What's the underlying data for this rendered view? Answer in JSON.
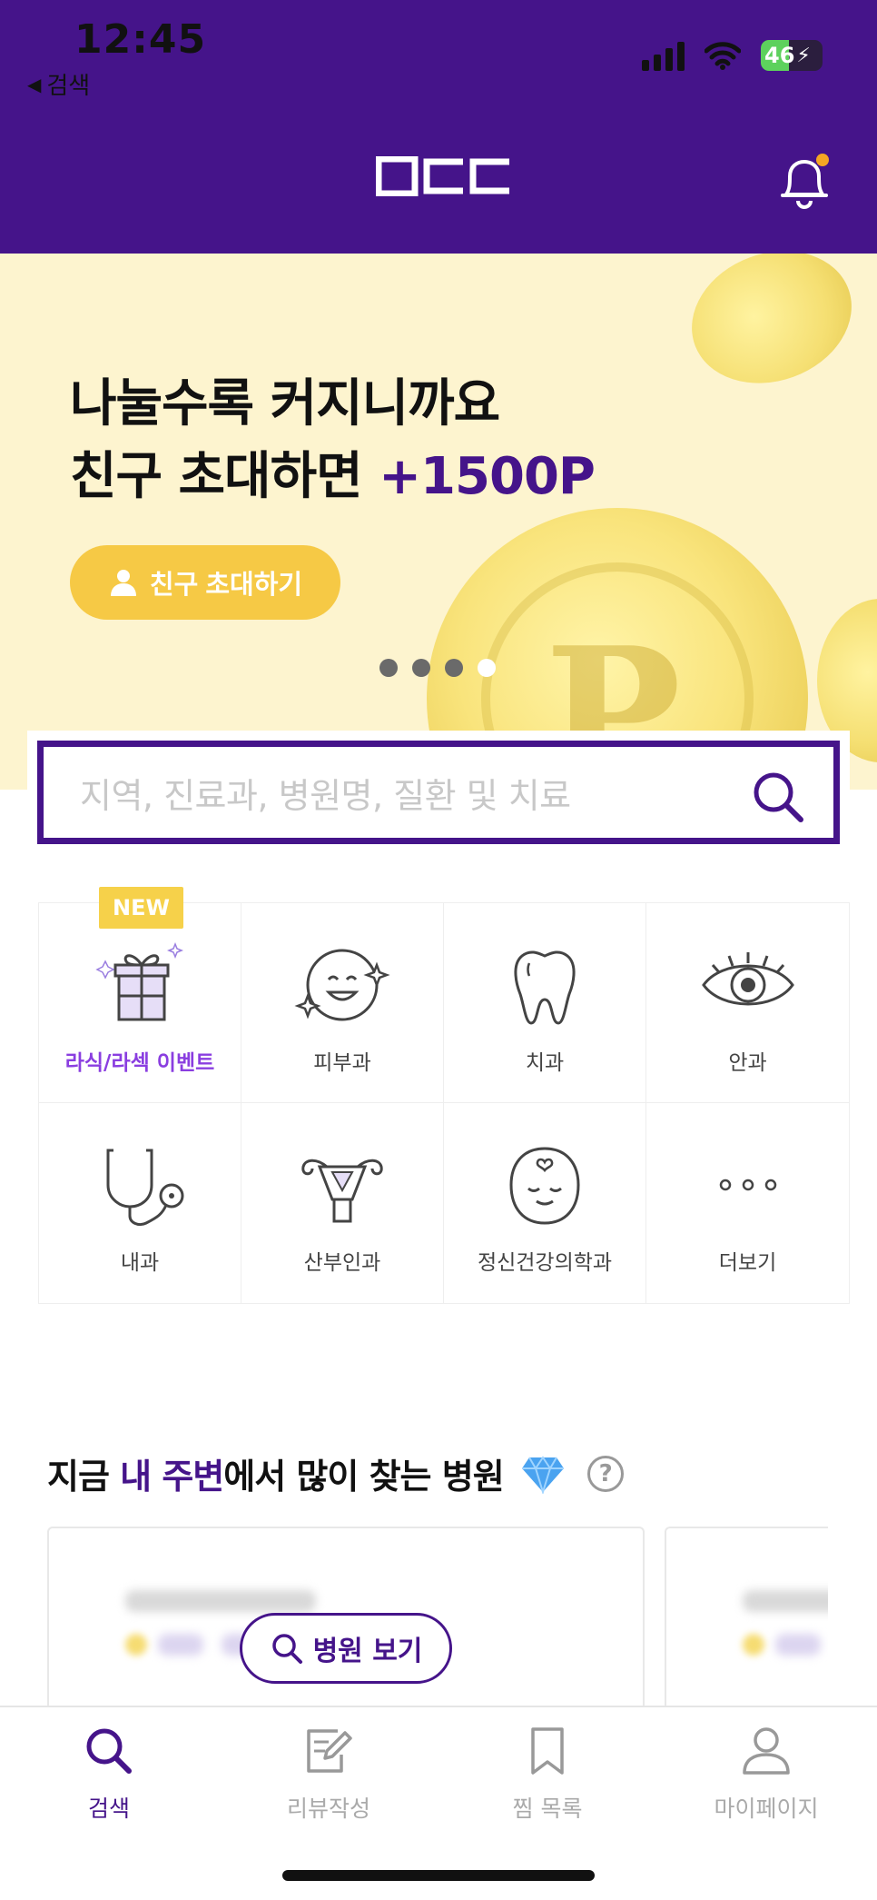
{
  "status_bar": {
    "time": "12:45",
    "back_label": "검색",
    "battery": "46"
  },
  "header": {
    "logo_text": "OCC",
    "has_notification": true
  },
  "banner": {
    "line1": "나눌수록 커지니까요",
    "line2_prefix": "친구 초대하면 ",
    "line2_accent": "+1500P",
    "button_label": "친구 초대하기",
    "page_count": 4,
    "active_page": 4
  },
  "search": {
    "placeholder": "지역, 진료과, 병원명, 질환 및 치료"
  },
  "categories": [
    {
      "label": "라식/라섹 이벤트",
      "badge": "NEW",
      "icon": "gift-icon"
    },
    {
      "label": "피부과",
      "icon": "smile-face-icon"
    },
    {
      "label": "치과",
      "icon": "tooth-icon"
    },
    {
      "label": "안과",
      "icon": "eye-icon"
    },
    {
      "label": "내과",
      "icon": "stethoscope-icon"
    },
    {
      "label": "산부인과",
      "icon": "uterus-icon"
    },
    {
      "label": "정신건강의학과",
      "icon": "calm-face-icon"
    },
    {
      "label": "더보기",
      "icon": "more-dots-icon"
    }
  ],
  "section": {
    "title_prefix": "지금 ",
    "title_accent": "내 주변",
    "title_suffix": "에서 많이 찾는 병원",
    "help": "?"
  },
  "view_hospital_button": "병원 보기",
  "bottom_nav": [
    {
      "label": "검색",
      "active": true
    },
    {
      "label": "리뷰작성",
      "active": false
    },
    {
      "label": "찜 목록",
      "active": false
    },
    {
      "label": "마이페이지",
      "active": false
    }
  ],
  "colors": {
    "brand_purple": "#45148a",
    "accent_yellow": "#f6c945",
    "banner_bg": "#fdf4cf",
    "notification_dot": "#f5a623"
  }
}
